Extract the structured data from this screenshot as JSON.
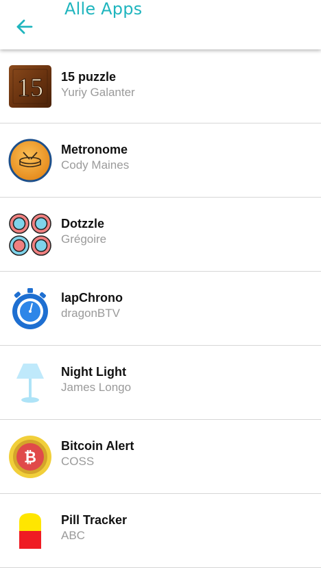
{
  "header": {
    "title": "Alle Apps"
  },
  "apps": [
    {
      "name": "15 puzzle",
      "author": "Yuriy Galanter",
      "icon": "puzzle-15-icon",
      "icon_text": "15"
    },
    {
      "name": "Metronome",
      "author": "Cody Maines",
      "icon": "metronome-drum-icon"
    },
    {
      "name": "Dotzzle",
      "author": "Grégoire",
      "icon": "dotzzle-circles-icon"
    },
    {
      "name": "lapChrono",
      "author": "dragonBTV",
      "icon": "stopwatch-icon"
    },
    {
      "name": "Night Light",
      "author": "James Longo",
      "icon": "lamp-icon"
    },
    {
      "name": "Bitcoin Alert",
      "author": "COSS",
      "icon": "bitcoin-icon",
      "icon_text": "₿"
    },
    {
      "name": "Pill Tracker",
      "author": "ABC",
      "icon": "pill-icon"
    }
  ],
  "colors": {
    "accent": "#1fb5be",
    "divider": "#d6d6d6",
    "secondary_text": "#9a9a9a"
  }
}
